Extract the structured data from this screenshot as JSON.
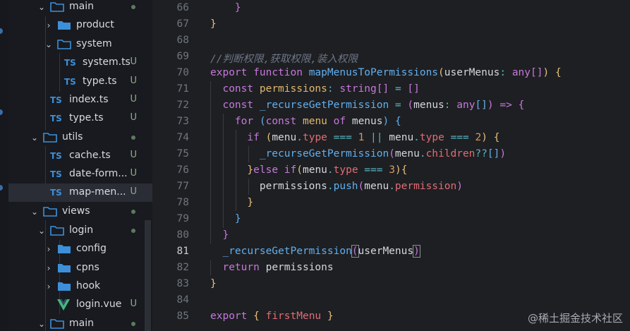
{
  "explorer": {
    "items": [
      {
        "label": "main",
        "kind": "folder",
        "open": true,
        "status": "dot"
      },
      {
        "label": "product",
        "kind": "folder",
        "open": false,
        "status": ""
      },
      {
        "label": "system",
        "kind": "folder",
        "open": true,
        "status": ""
      },
      {
        "label": "system.ts",
        "kind": "ts",
        "status": "U"
      },
      {
        "label": "type.ts",
        "kind": "ts",
        "status": "U"
      },
      {
        "label": "index.ts",
        "kind": "ts",
        "status": "U"
      },
      {
        "label": "type.ts",
        "kind": "ts",
        "status": "U"
      },
      {
        "label": "utils",
        "kind": "folder",
        "open": true,
        "status": "dot"
      },
      {
        "label": "cache.ts",
        "kind": "ts",
        "status": "U"
      },
      {
        "label": "date-form...",
        "kind": "ts",
        "status": "U"
      },
      {
        "label": "map-men...",
        "kind": "ts",
        "status": "U"
      },
      {
        "label": "views",
        "kind": "folder",
        "open": true,
        "status": "dot"
      },
      {
        "label": "login",
        "kind": "folder",
        "open": true,
        "status": "dot"
      },
      {
        "label": "config",
        "kind": "folder",
        "open": false,
        "status": ""
      },
      {
        "label": "cpns",
        "kind": "folder",
        "open": false,
        "status": ""
      },
      {
        "label": "hook",
        "kind": "folder",
        "open": false,
        "status": ""
      },
      {
        "label": "login.vue",
        "kind": "vue",
        "status": "U"
      },
      {
        "label": "main",
        "kind": "folder",
        "open": true,
        "status": "dot"
      }
    ],
    "ts_badge": "TS"
  },
  "editor": {
    "lines": [
      {
        "num": "66",
        "text": "    }"
      },
      {
        "num": "67",
        "text": "  }"
      },
      {
        "num": "68",
        "text": ""
      },
      {
        "num": "69",
        "text": "//判断权限,获取权限,装入权限"
      },
      {
        "num": "70",
        "text": "export function mapMenusToPermissions(userMenus: any[]) {"
      },
      {
        "num": "71",
        "text": "  const permissions: string[] = []"
      },
      {
        "num": "72",
        "text": "  const _recurseGetPermission = (menus: any[]) => {"
      },
      {
        "num": "73",
        "text": "    for (const menu of menus) {"
      },
      {
        "num": "74",
        "text": "      if (menu.type === 1 || menu.type === 2) {"
      },
      {
        "num": "75",
        "text": "        _recurseGetPermission(menu.children??[])"
      },
      {
        "num": "76",
        "text": "      }else if(menu.type === 3){"
      },
      {
        "num": "77",
        "text": "        permissions.push(menu.permission)"
      },
      {
        "num": "78",
        "text": "      }"
      },
      {
        "num": "79",
        "text": "    }"
      },
      {
        "num": "80",
        "text": "  }"
      },
      {
        "num": "81",
        "text": "  _recurseGetPermission(userMenus)"
      },
      {
        "num": "82",
        "text": "  return permissions"
      },
      {
        "num": "83",
        "text": "}"
      },
      {
        "num": "84",
        "text": ""
      },
      {
        "num": "85",
        "text": "export { firstMenu }"
      }
    ],
    "active_line": "81"
  },
  "watermark": "@稀土掘金技术社区"
}
